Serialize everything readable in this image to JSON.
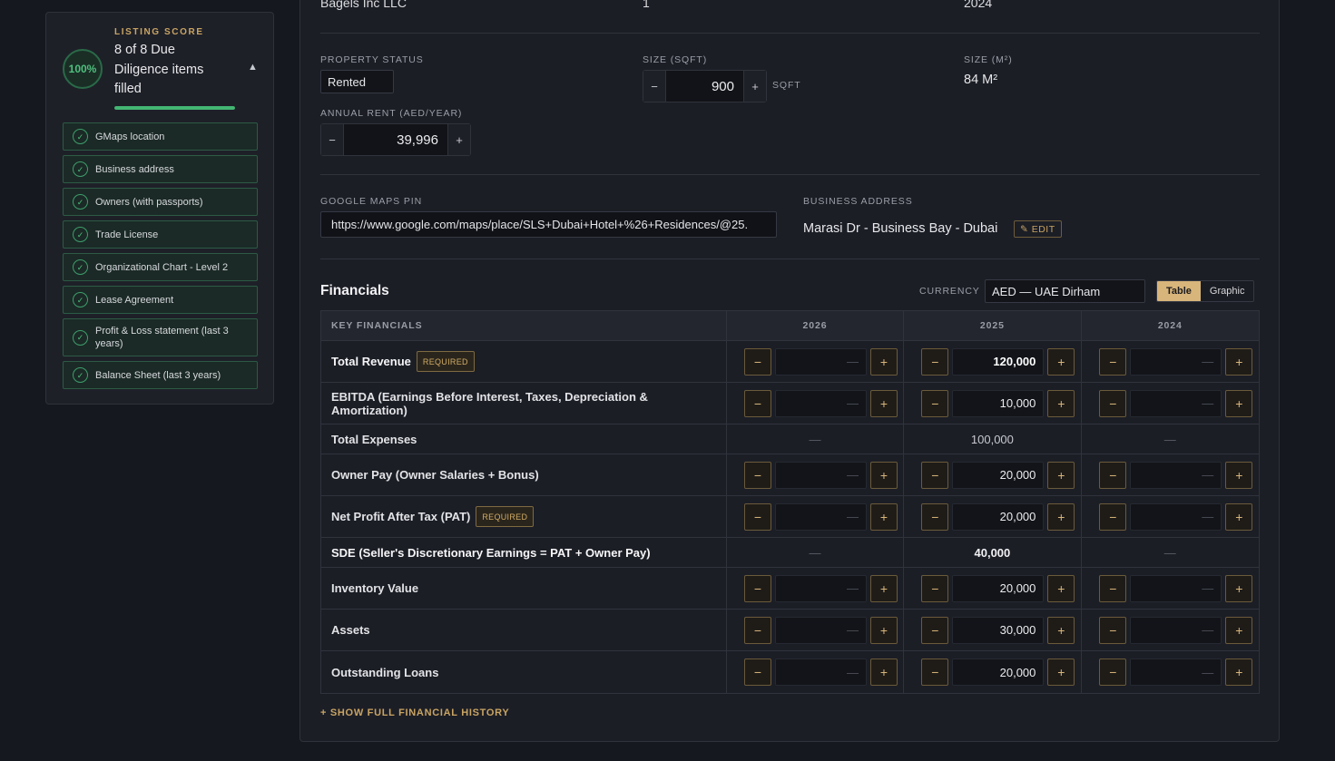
{
  "score": {
    "kicker": "LISTING SCORE",
    "percent": "100%",
    "summary": "8 of 8 Due Diligence items filled",
    "toggle_icon": "▲",
    "progress_fraction": 1.0,
    "items": [
      {
        "label": "GMaps location"
      },
      {
        "label": "Business address"
      },
      {
        "label": "Owners (with passports)"
      },
      {
        "label": "Trade License"
      },
      {
        "label": "Organizational Chart - Level 2"
      },
      {
        "label": "Lease Agreement"
      },
      {
        "label": "Profit & Loss statement (last 3 years)"
      },
      {
        "label": "Balance Sheet (last 3 years)"
      }
    ]
  },
  "top_row": {
    "company": "Bagels Inc LLC",
    "count": "1",
    "year": "2024"
  },
  "property": {
    "status_label": "PROPERTY STATUS",
    "status_value": "Rented",
    "size_sqft_label": "SIZE (SQFT)",
    "size_sqft_value": "900",
    "size_sqft_unit": "SQFT",
    "size_m2_label": "SIZE (M²)",
    "size_m2_value": "84 M²",
    "rent_label": "ANNUAL RENT (AED/YEAR)",
    "rent_value": "39,996",
    "minus": "−",
    "plus": "+"
  },
  "location": {
    "gmaps_label": "GOOGLE MAPS PIN",
    "gmaps_value": "https://www.google.com/maps/place/SLS+Dubai+Hotel+%26+Residences/@25.",
    "address_label": "BUSINESS ADDRESS",
    "address_value": "Marasi Dr - Business Bay - Dubai",
    "edit_label": "✎ EDIT"
  },
  "financials": {
    "title": "Financials",
    "currency_label": "CURRENCY",
    "currency_value": "AED — UAE Dirham",
    "view_table": "Table",
    "view_graphic": "Graphic",
    "header": {
      "key": "KEY FINANCIALS",
      "y1": "2026",
      "y2": "2025",
      "y3": "2024"
    },
    "required_tag": "REQUIRED",
    "empty_mark": "—",
    "minus": "−",
    "plus": "+",
    "show_history": "+ SHOW FULL FINANCIAL HISTORY",
    "rows": [
      {
        "label": "Total Revenue",
        "y2026": "—",
        "y2025": "120,000",
        "y2024": "—"
      },
      {
        "label": "EBITDA (Earnings Before Interest, Taxes, Depreciation & Amortization)",
        "y2026": "—",
        "y2025": "10,000",
        "y2024": "—"
      },
      {
        "label": "Total Expenses",
        "y2026": "—",
        "y2025": "100,000",
        "y2024": "—"
      },
      {
        "label": "Owner Pay (Owner Salaries + Bonus)",
        "y2026": "—",
        "y2025": "20,000",
        "y2024": "—"
      },
      {
        "label": "Net Profit After Tax (PAT)",
        "y2026": "—",
        "y2025": "20,000",
        "y2024": "—"
      },
      {
        "label": "SDE (Seller's Discretionary Earnings = PAT + Owner Pay)",
        "y2026": "—",
        "y2025": "40,000",
        "y2024": "—"
      },
      {
        "label": "Inventory Value",
        "y2026": "—",
        "y2025": "20,000",
        "y2024": "—"
      },
      {
        "label": "Assets",
        "y2026": "—",
        "y2025": "30,000",
        "y2024": "—"
      },
      {
        "label": "Outstanding Loans",
        "y2026": "—",
        "y2025": "20,000",
        "y2024": "—"
      }
    ]
  }
}
